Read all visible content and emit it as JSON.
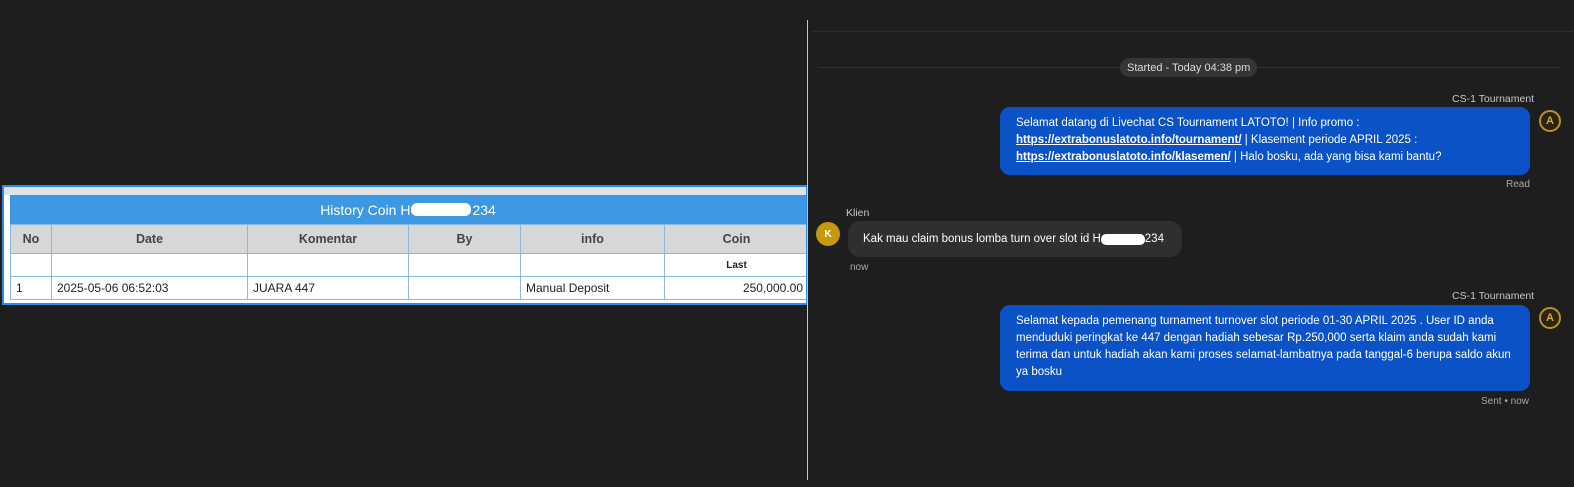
{
  "history": {
    "title_prefix": "History Coin H",
    "title_suffix": "234",
    "columns": [
      "No",
      "Date",
      "Komentar",
      "By",
      "info",
      "Coin"
    ],
    "last_label": "Last",
    "rows": [
      {
        "no": "1",
        "date": "2025-05-06 06:52:03",
        "komentar": "JUARA 447",
        "by": "",
        "info": "Manual Deposit",
        "coin": "250,000.00"
      }
    ]
  },
  "chat": {
    "started": "Started - Today 04:38 pm",
    "messages": [
      {
        "sender": "CS-1 Tournament",
        "avatar": "A",
        "text_1": "Selamat datang di Livechat CS Tournament LATOTO! | Info promo :",
        "link_1": "https://extrabonuslatoto.info/tournament/",
        "text_2": " | Klasement periode APRIL 2025 :",
        "link_2": "https://extrabonuslatoto.info/klasemen/",
        "text_3": " | Halo bosku, ada yang bisa kami bantu?",
        "status": "Read"
      },
      {
        "sender": "Klien",
        "avatar": "K",
        "text_prefix": "Kak mau claim bonus lomba turn over slot id H",
        "text_suffix": "234",
        "time": "now"
      },
      {
        "sender": "CS-1 Tournament",
        "avatar": "A",
        "text": "Selamat kepada pemenang turnament turnover slot periode 01-30 APRIL 2025 . User ID anda menduduki peringkat ke 447 dengan hadiah sebesar Rp.250,000 serta klaim anda sudah kami terima dan untuk hadiah akan kami proses selamat-lambatnya pada tanggal-6 berupa saldo akun ya bosku",
        "status": "Sent • now"
      }
    ]
  },
  "colors": {
    "background": "#1e1e1f",
    "table_header_blue": "#3d98e4",
    "agent_bubble": "#0c52c7",
    "client_bubble": "#2f2f31",
    "coin_green": "#1a8a1a",
    "client_avatar": "#c39a0e"
  }
}
